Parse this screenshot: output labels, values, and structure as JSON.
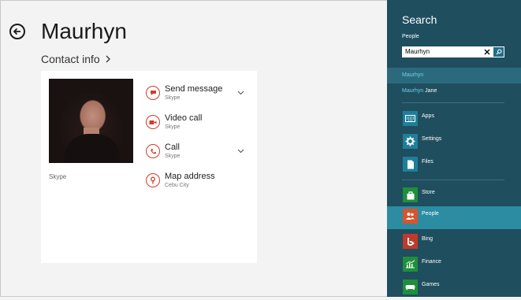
{
  "contact": {
    "name": "Maurhyn",
    "contact_info_label": "Contact info",
    "photo_caption": "Skype",
    "actions": [
      {
        "label": "Send message",
        "sub": "Skype"
      },
      {
        "label": "Video call",
        "sub": "Skype"
      },
      {
        "label": "Call",
        "sub": "Skype"
      },
      {
        "label": "Map address",
        "sub": "Cebu City"
      }
    ]
  },
  "search": {
    "title": "Search",
    "scope": "People",
    "query": "Maurhyn",
    "suggestions": [
      {
        "match": "Maurhyn",
        "rest": ""
      },
      {
        "match": "Maurhyn",
        "rest": " Jane"
      }
    ],
    "apps": [
      "Apps",
      "Settings",
      "Files",
      "Store",
      "People",
      "Bing",
      "Finance",
      "Games"
    ],
    "selected_app": "People"
  },
  "colors": {
    "charm_bg": "#1f4e5f",
    "accent": "#d23c2a",
    "highlight": "#6dd0ea"
  }
}
